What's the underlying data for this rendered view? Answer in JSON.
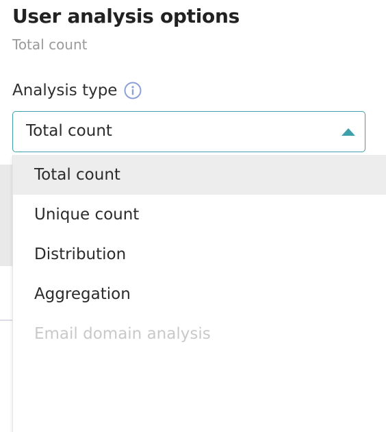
{
  "header": {
    "title": "User analysis options",
    "subtitle": "Total count"
  },
  "field": {
    "label": "Analysis type",
    "info_icon": "info-circle-icon",
    "selected_value": "Total count",
    "caret_icon": "caret-up-icon"
  },
  "dropdown": {
    "options": [
      {
        "label": "Total count",
        "state": "highlighted"
      },
      {
        "label": "Unique count",
        "state": "enabled"
      },
      {
        "label": "Distribution",
        "state": "enabled"
      },
      {
        "label": "Aggregation",
        "state": "enabled"
      },
      {
        "label": "Email domain analysis",
        "state": "disabled"
      }
    ]
  },
  "colors": {
    "accent": "#3ea0aa",
    "highlight": "#ededed",
    "disabled_text": "#c9c9c9",
    "subtitle_text": "#9a9a9a",
    "info_icon": "#8aa0d8"
  }
}
